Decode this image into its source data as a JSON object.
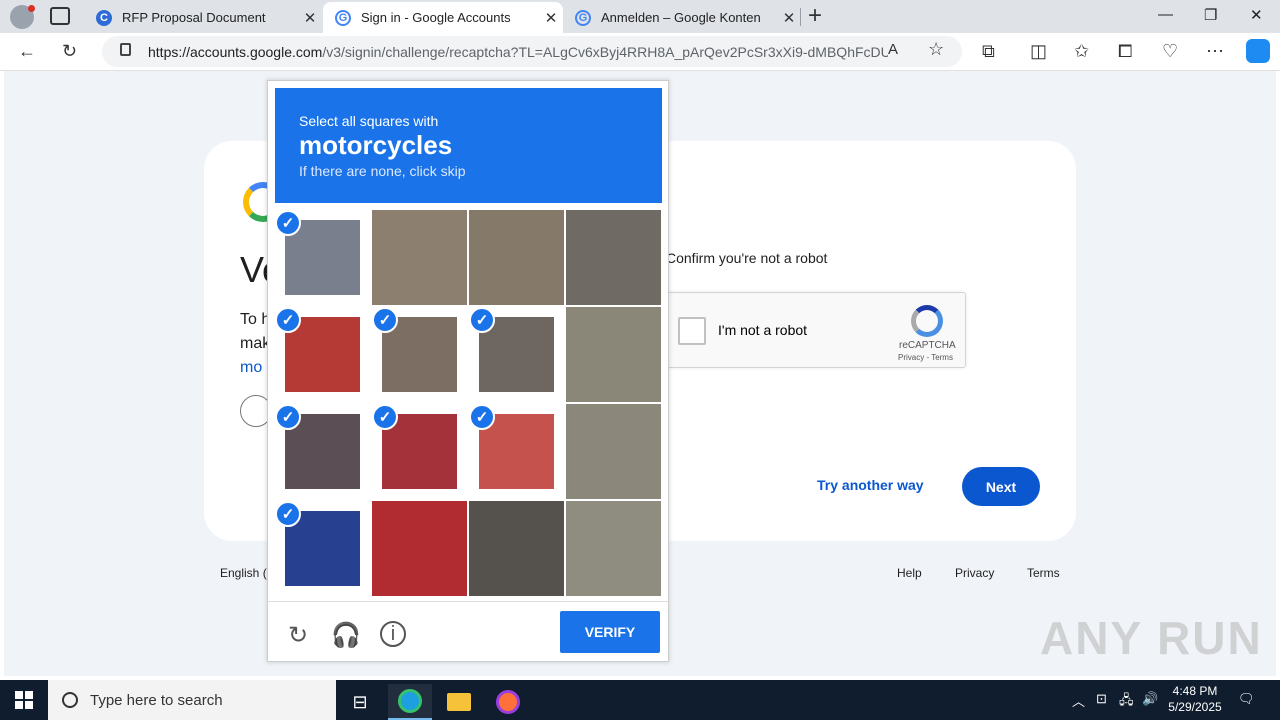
{
  "browser": {
    "tabs": [
      {
        "title": "RFP Proposal Document",
        "active": false
      },
      {
        "title": "Sign in - Google Accounts",
        "active": true
      },
      {
        "title": "Anmelden – Google Konten",
        "active": false
      }
    ],
    "url_host": "https://accounts.google.com",
    "url_path": "/v3/signin/challenge/recaptcha?TL=ALgCv6xByj4RRH8A_pArQev2PcSr3xXi9-dMBQhFcDU..."
  },
  "page": {
    "heading_partial": "Ve",
    "line1_partial": "To h",
    "line2_partial": "mak",
    "line3_partial": "mo",
    "confirm_text": "Confirm you're not a robot",
    "recaptcha_checkbox_label": "I'm not a robot",
    "recaptcha_brand": "reCAPTCHA",
    "recaptcha_links": "Privacy - Terms",
    "try_another_way": "Try another way",
    "next_button": "Next",
    "footer_lang": "English (",
    "footer_help": "Help",
    "footer_privacy": "Privacy",
    "footer_terms": "Terms",
    "watermark": "ANY RUN"
  },
  "challenge": {
    "prompt_line1": "Select all squares with",
    "prompt_object": "motorcycles",
    "prompt_line3": "If there are none, click skip",
    "tiles": [
      {
        "selected": true,
        "color": "#7a7f8e"
      },
      {
        "selected": false,
        "color": "#8c7f70"
      },
      {
        "selected": false,
        "color": "#857a6a"
      },
      {
        "selected": false,
        "color": "#6f6a63"
      },
      {
        "selected": true,
        "color": "#b53a35"
      },
      {
        "selected": true,
        "color": "#7d6e63"
      },
      {
        "selected": true,
        "color": "#6e6660"
      },
      {
        "selected": false,
        "color": "#8a8678"
      },
      {
        "selected": true,
        "color": "#5b4f55"
      },
      {
        "selected": true,
        "color": "#a3323b"
      },
      {
        "selected": true,
        "color": "#c5524c"
      },
      {
        "selected": false,
        "color": "#8b887b"
      },
      {
        "selected": true,
        "color": "#27408f"
      },
      {
        "selected": false,
        "color": "#b02c30"
      },
      {
        "selected": false,
        "color": "#55514c"
      },
      {
        "selected": false,
        "color": "#8f8c80"
      }
    ],
    "verify_button": "VERIFY",
    "tools": [
      "reload-icon",
      "headphones-icon",
      "info-icon"
    ]
  },
  "taskbar": {
    "search_placeholder": "Type here to search",
    "time": "4:48 PM",
    "date": "5/29/2025"
  }
}
